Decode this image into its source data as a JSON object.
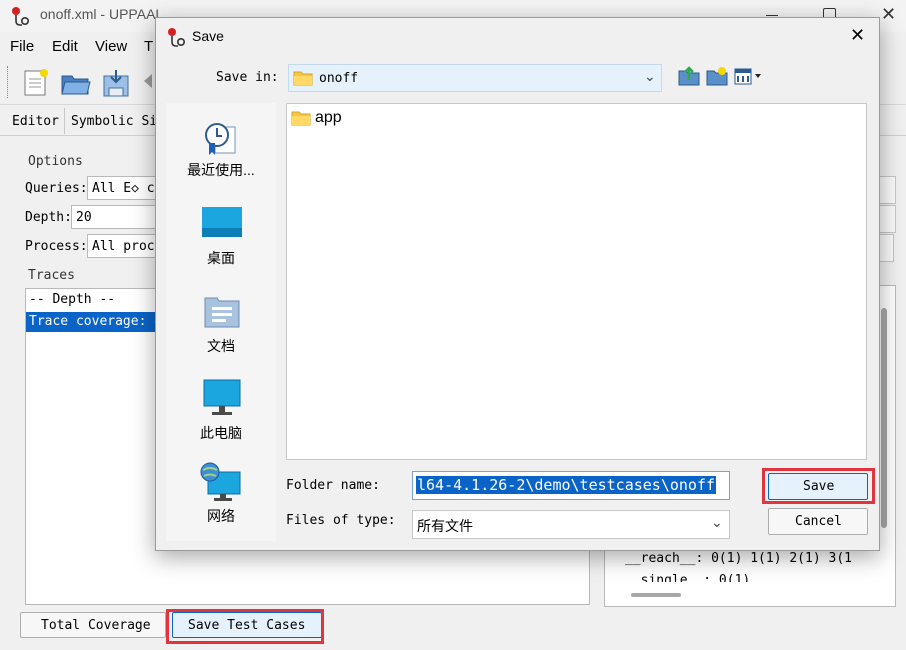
{
  "app": {
    "title": "onoff.xml - UPPAAL",
    "menu": [
      "File",
      "Edit",
      "View",
      "T"
    ],
    "tabs": [
      "Editor",
      "Symbolic Si"
    ],
    "options_label": "Options",
    "queries_label": "Queries:",
    "queries_value": "All E◇ c",
    "depth_label": "Depth:",
    "depth_value": "20",
    "process_label": "Process:",
    "process_value": "All proce",
    "traces_label": "Traces",
    "traces_items": [
      "-- Depth --",
      "Trace coverage: 4"
    ],
    "right_lines": [
      "__reach__: 0(1) 1(1) 2(1) 3(1",
      "__single__: 0(1)"
    ],
    "total_coverage_button": "Total Coverage",
    "save_test_cases_button": "Save Test Cases"
  },
  "dialog": {
    "title": "Save",
    "save_in_label": "Save in:",
    "save_in_value": "onoff",
    "places": [
      "最近使用...",
      "桌面",
      "文档",
      "此电脑",
      "网络"
    ],
    "files": [
      "app"
    ],
    "folder_name_label": "Folder name:",
    "folder_name_value": "l64-4.1.26-2\\demo\\testcases\\onoff",
    "files_of_type_label": "Files of type:",
    "files_of_type_value": "所有文件",
    "save_button": "Save",
    "cancel_button": "Cancel",
    "close_symbol": "✕"
  },
  "colors": {
    "selection": "#0a64c8",
    "highlight_box": "#e0343e",
    "address_bg": "#e5f1fb"
  }
}
